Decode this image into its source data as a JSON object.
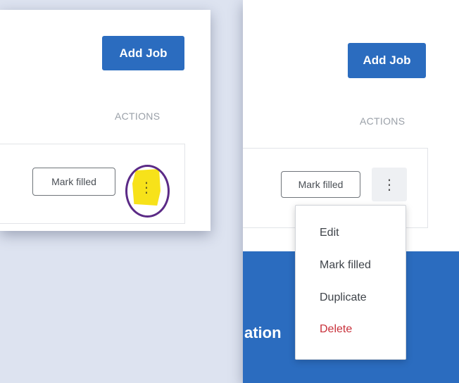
{
  "colors": {
    "background": "#dde3f0",
    "primary": "#2b6cbf",
    "danger": "#c8303a",
    "highlight": "#f7e21a",
    "annotation_circle": "#5b2a86"
  },
  "left_panel": {
    "add_job_label": "Add Job",
    "actions_header": "ACTIONS",
    "mark_filled_label": "Mark filled",
    "kebab_glyph": "⋮"
  },
  "right_panel": {
    "add_job_label": "Add Job",
    "actions_header": "ACTIONS",
    "mark_filled_label": "Mark filled",
    "kebab_glyph": "⋮",
    "band_text": "ation"
  },
  "dropdown_menu": {
    "items": [
      {
        "label": "Edit"
      },
      {
        "label": "Mark filled"
      },
      {
        "label": "Duplicate"
      },
      {
        "label": "Delete"
      }
    ]
  }
}
